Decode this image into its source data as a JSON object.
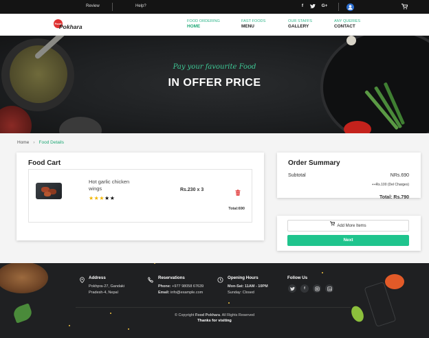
{
  "topbar": {
    "review": "Review",
    "help": "Help?",
    "social": [
      {
        "icon": "facebook-icon",
        "glyph": "f"
      },
      {
        "icon": "twitter-icon",
        "glyph": "t"
      },
      {
        "icon": "google-plus-icon",
        "glyph": "G+"
      }
    ]
  },
  "nav": {
    "logo_badge": "Food",
    "logo_text": "Pokhara",
    "items": [
      {
        "sup": "FOOD ORDERING",
        "label": "HOME"
      },
      {
        "sup": "FAST FOODS",
        "label": "MENU"
      },
      {
        "sup": "OUR STAFFS",
        "label": "GALLERY"
      },
      {
        "sup": "ANY QUERIES",
        "label": "CONTACT"
      }
    ]
  },
  "hero": {
    "tagline": "Pay your favourite Food",
    "title": "IN OFFER PRICE"
  },
  "breadcrumb": {
    "home": "Home",
    "current": "Food Details"
  },
  "cart": {
    "title": "Food Cart",
    "item": {
      "name": "Hot garlic chicken wings",
      "rating": 3,
      "rating_max": 5,
      "price": "Rs.230 x 3",
      "total": "Total:690"
    }
  },
  "summary": {
    "title": "Order Summary",
    "subtotal_label": "Subtotal",
    "subtotal_value": "NRs.690",
    "charges": "++Rs.100 (Del Charges)",
    "total": "Total: Rs.790"
  },
  "actions": {
    "add_more": "Add More Items",
    "next": "Next"
  },
  "footer": {
    "address": {
      "heading": "Address",
      "lines": [
        "Pokhpra-27, Gandaki",
        "Pradesh-4, Nepal"
      ]
    },
    "reservations": {
      "heading": "Reservations",
      "phone_label": "Phone:",
      "phone": "+977 98058 67639",
      "email_label": "Email:",
      "email": "info@example.com"
    },
    "hours": {
      "heading": "Opening Hours",
      "weekdays": "Mon-Sat: 11AM - 10PM",
      "sunday": "Sunday: Closed"
    },
    "follow": {
      "heading": "Follow Us"
    },
    "copyright_prefix": "© Copyright",
    "copyright_brand": "Food Pokhara",
    "copyright_suffix": ". All Rights Reserved",
    "thanks": "Thanks for visiting"
  },
  "colors": {
    "accent": "#1fc48d",
    "brand_red": "#e03232",
    "footer_bg": "#1f2022",
    "topbar_bg": "#141414"
  }
}
